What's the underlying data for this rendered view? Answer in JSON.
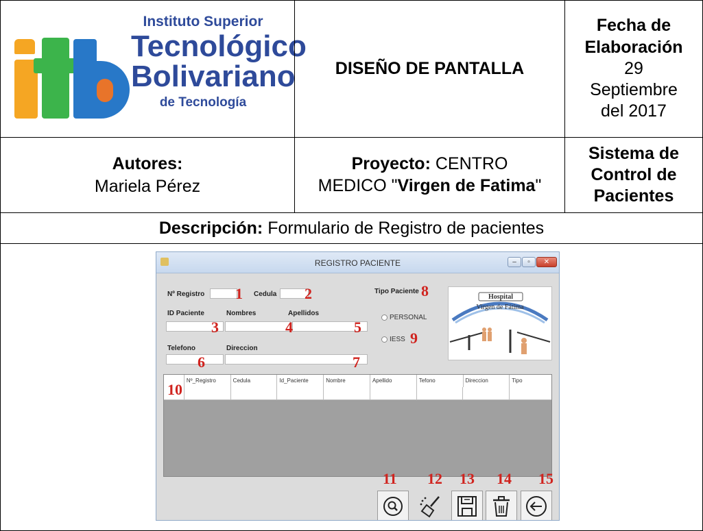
{
  "header": {
    "logo": {
      "line1": "Instituto Superior",
      "line2": "Tecnológico",
      "line3": "Bolivariano",
      "line4": "de Tecnología"
    },
    "title": "DISEÑO DE PANTALLA",
    "fecha_label": "Fecha de Elaboración",
    "fecha_day": "29",
    "fecha_month": "Septiembre",
    "fecha_year": "del 2017"
  },
  "authors": {
    "label": "Autores:",
    "name": "Mariela Pérez"
  },
  "project": {
    "label": "Proyecto:",
    "text1": " CENTRO MEDICO \"",
    "name": "Virgen de Fatima",
    "text2": "\""
  },
  "system": {
    "label": "Sistema de Control de Pacientes"
  },
  "description": {
    "label": "Descripción:",
    "text": " Formulario de Registro de pacientes"
  },
  "window": {
    "title": "REGISTRO PACIENTE",
    "labels": {
      "registro": "Nº Registro",
      "cedula": "Cedula",
      "id_paciente": "ID Paciente",
      "nombres": "Nombres",
      "apellidos": "Apellidos",
      "telefono": "Telefono",
      "direccion": "Direccion",
      "tipo_paciente": "Tipo Paciente"
    },
    "radios": {
      "personal": "PERSONAL",
      "iess": "IESS"
    },
    "hospital_sign": "Hospital",
    "hospital_name": "Virgen de Fátima",
    "grid_columns": [
      "Nº_Registro",
      "Cedula",
      "Id_Paciente",
      "Nombre",
      "Apellido",
      "Tefono",
      "Direccion",
      "Tipo"
    ],
    "markers": [
      "1",
      "2",
      "3",
      "4",
      "5",
      "6",
      "7",
      "8",
      "9",
      "10",
      "11",
      "12",
      "13",
      "14",
      "15"
    ]
  },
  "colors": {
    "marker": "#d0231e",
    "logo_orange": "#f5a623",
    "logo_green": "#3cb44b",
    "logo_blue": "#2878c8",
    "logo_text": "#2e4a9a"
  }
}
